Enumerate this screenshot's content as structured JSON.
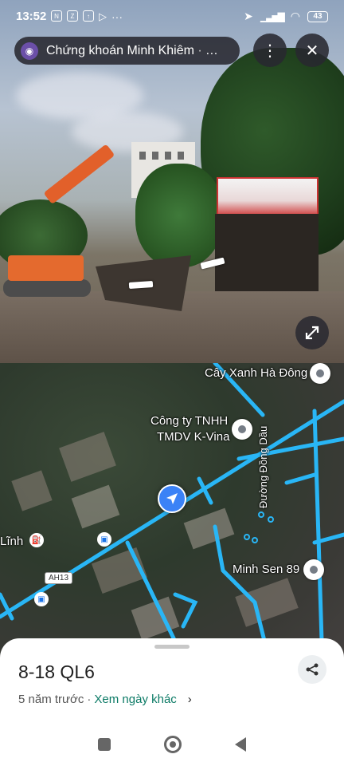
{
  "status_bar": {
    "time": "13:52",
    "notification_icons": [
      "nfc-icon",
      "zalo-icon",
      "upload-icon",
      "play-icon",
      "more-icon"
    ],
    "battery": "43"
  },
  "street_view": {
    "chip_title": "Chứng khoán Minh Khiêm",
    "chip_subtitle": " · Th...",
    "more_icon": "⋮",
    "close_icon": "✕"
  },
  "map": {
    "labels": {
      "cay_xanh": "Cây Xanh Hà Đông",
      "cong_ty_line1": "Công ty TNHH",
      "cong_ty_line2": "TMDV K-Vina",
      "duong_dong_dau": "Đường Đồng Dầu",
      "minh_sen": "Minh Sen 89",
      "linh": "Lĩnh",
      "route": "AH13"
    },
    "road_color": "#29b6f6"
  },
  "sheet": {
    "title": "8-18 QL6",
    "age": "5 năm trước",
    "separator": "·",
    "other_dates": "Xem ngày khác",
    "chevron": "›"
  }
}
